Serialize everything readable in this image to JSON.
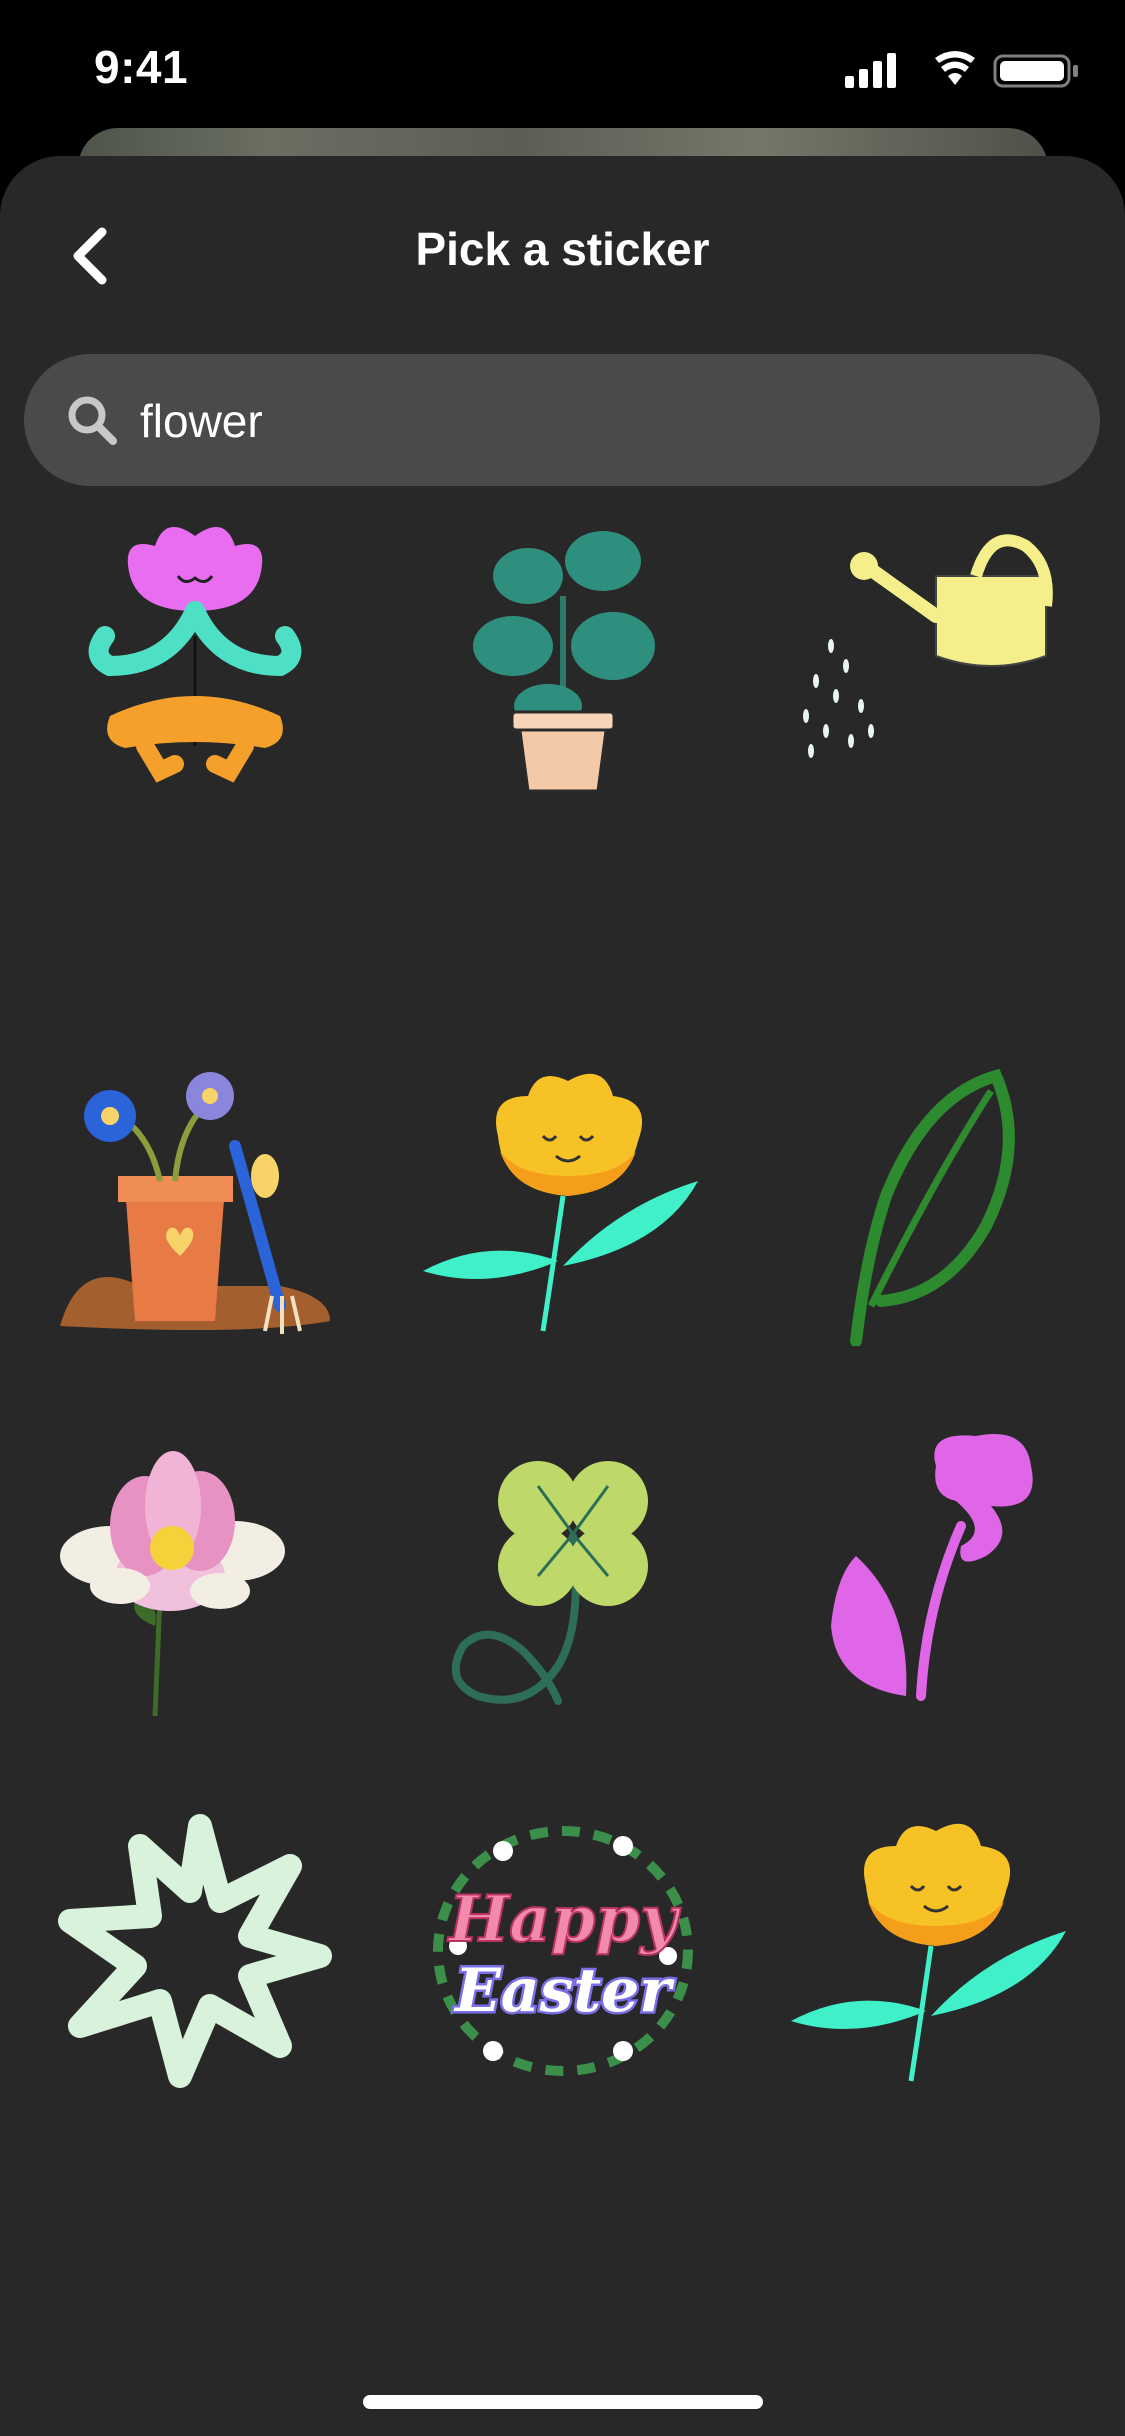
{
  "status_bar": {
    "time": "9:41",
    "icons": [
      "signal-icon",
      "wifi-icon",
      "battery-icon"
    ]
  },
  "header": {
    "title": "Pick a sticker",
    "back_icon": "chevron-left-icon"
  },
  "search": {
    "value": "flower",
    "icon": "search-icon"
  },
  "stickers": [
    {
      "name": "meditating-flower-sticker"
    },
    {
      "name": "potted-monstera-sticker"
    },
    {
      "name": "watering-can-sticker"
    },
    {
      "name": "flower-pot-garden-sticker"
    },
    {
      "name": "yellow-smiling-flower-sticker"
    },
    {
      "name": "green-leaf-sticker"
    },
    {
      "name": "water-lily-sticker"
    },
    {
      "name": "four-leaf-clover-sticker"
    },
    {
      "name": "pink-brush-flower-sticker"
    },
    {
      "name": "mint-star-outline-sticker"
    },
    {
      "name": "happy-easter-sticker",
      "text_line1": "Happy",
      "text_line2": "Easter"
    },
    {
      "name": "yellow-smiling-flower-sticker-2"
    }
  ],
  "colors": {
    "sheet_bg": "#282828",
    "search_bg": "#4a4a4a",
    "text": "#ffffff"
  }
}
